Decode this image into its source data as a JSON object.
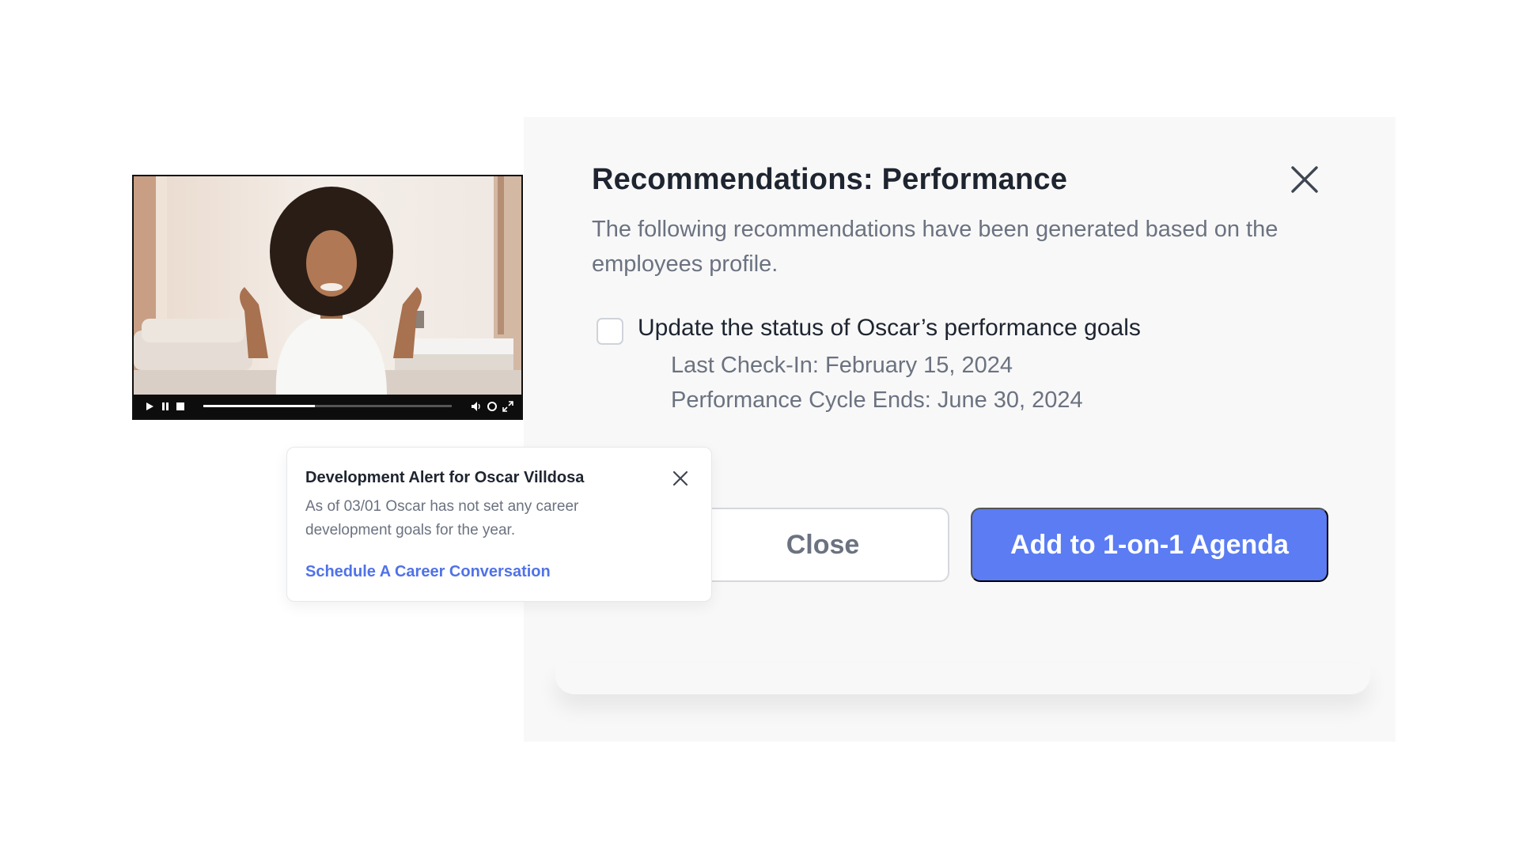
{
  "recommendations": {
    "title": "Recommendations: Performance",
    "description": "The following recommendations have been generated based on the employees profile.",
    "item": {
      "checked": false,
      "title": "Update the status of Oscar’s performance goals",
      "last_checkin": "Last Check-In: February 15, 2024",
      "cycle_end": "Performance Cycle Ends: June 30, 2024"
    },
    "close_label": "Close",
    "add_label": "Add to 1-on-1 Agenda",
    "accent_color": "#5b7cf2"
  },
  "video": {
    "progress": 0.45
  },
  "alert": {
    "title": "Development Alert for Oscar Villdosa",
    "body": "As of 03/01 Oscar has not set any career development goals for the year.",
    "link": "Schedule A Career Conversation",
    "link_color": "#4f72e8"
  }
}
